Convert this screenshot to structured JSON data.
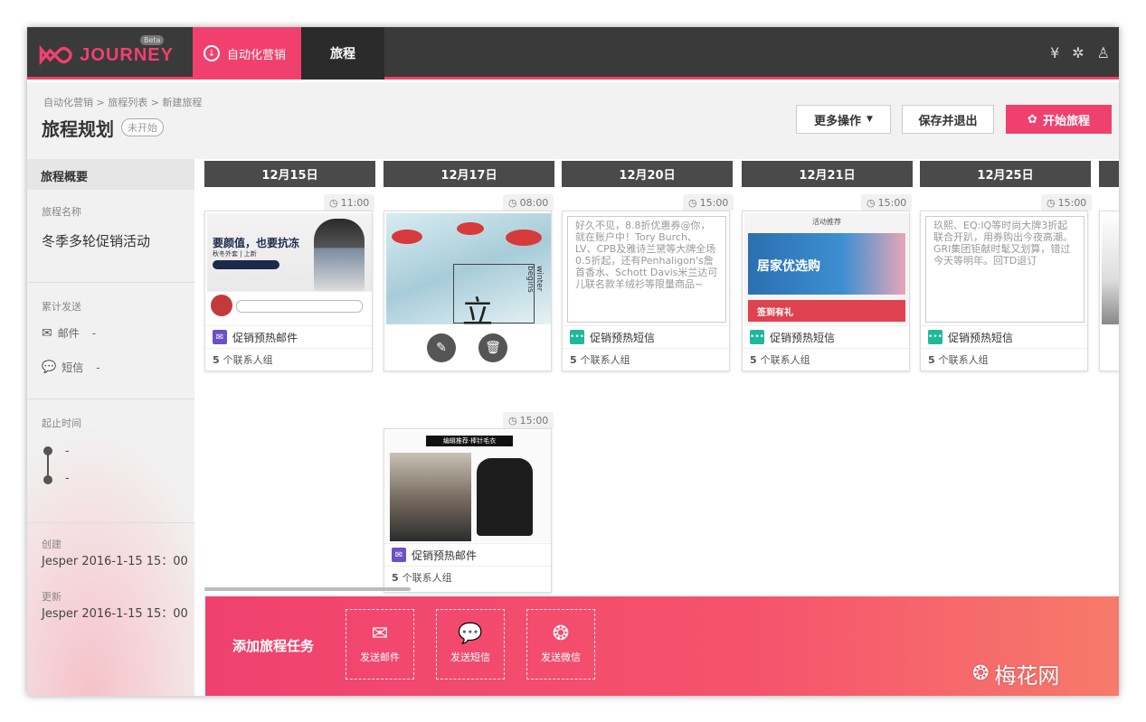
{
  "app": {
    "logo_text": "JOURNEY",
    "beta": "Beta",
    "nav_active": "自动化营销",
    "nav_tab": "旅程",
    "icons": [
      "yen-icon",
      "gear-icon",
      "user-icon"
    ]
  },
  "header": {
    "breadcrumb": "自动化营销 > 旅程列表 > 新建旅程",
    "title": "旅程规划",
    "status": "未开始",
    "more_label": "更多操作",
    "save_label": "保存并退出",
    "start_label": "开始旅程"
  },
  "sidebar": {
    "overview": "旅程概要",
    "name_label": "旅程名称",
    "name_value": "冬季多轮促销活动",
    "sent_label": "累计发送",
    "mail_label": "邮件",
    "mail_value": "-",
    "sms_label": "短信",
    "sms_value": "-",
    "time_label": "起止时间",
    "start_value": "-",
    "end_value": "-",
    "created_label": "创建",
    "created_value": "Jesper 2016-1-15 15：00",
    "updated_label": "更新",
    "updated_value": "Jesper 2016-1-15 15：00"
  },
  "columns": [
    {
      "date": "12月15日"
    },
    {
      "date": "12月17日"
    },
    {
      "date": "12月20日"
    },
    {
      "date": "12月21日"
    },
    {
      "date": "12月25日"
    }
  ],
  "cards": {
    "c1": {
      "time": "11:00",
      "type": "促销预热邮件",
      "count": "5",
      "count_suffix": "个联系人组",
      "img_headline": "要颜值，也要抗冻",
      "img_sub": "秋冬外套 | 上新"
    },
    "c2": {
      "time": "08:00",
      "img_text": "立",
      "img_side": "winter begins"
    },
    "c3": {
      "time": "15:00",
      "type": "促销预热短信",
      "count": "5",
      "count_suffix": "个联系人组",
      "text": "好久不见，8.8折优惠券@你，就在账户中！Tory Burch、LV、CPB及雅诗兰黛等大牌全场0.5折起，还有Penhaligon's詹首香水、Schott Davis米兰达可儿联名款羊绒衫等限量商品~"
    },
    "c4": {
      "time": "15:00",
      "type": "促销预热短信",
      "count": "5",
      "count_suffix": "个联系人组",
      "img_top": "活动推荐",
      "img_main": "居家优选购",
      "img_bottom": "签到有礼"
    },
    "c5": {
      "time": "15:00",
      "type": "促销预热短信",
      "count": "5",
      "count_suffix": "个联系人组",
      "text": "玖熙、EQ:IQ等时尚大牌3折起联合开趴，用券购出今夜高潮。GRI集团钜献时髦又划算，错过今天等明年。回TD退订"
    },
    "c6": {
      "time": "15:00",
      "type": "促销预热邮件",
      "count": "5",
      "count_suffix": "个联系人组",
      "img_banner": "编辑推荐·棒针毛衣"
    }
  },
  "bottom": {
    "title": "添加旅程任务",
    "mail": "发送邮件",
    "sms": "发送短信",
    "wechat": "发送微信"
  },
  "watermark": "梅花网",
  "colors": {
    "accent": "#f0416e",
    "dark": "#3a3a3a",
    "mail": "#6d4fc9",
    "sms": "#1fb89b"
  }
}
